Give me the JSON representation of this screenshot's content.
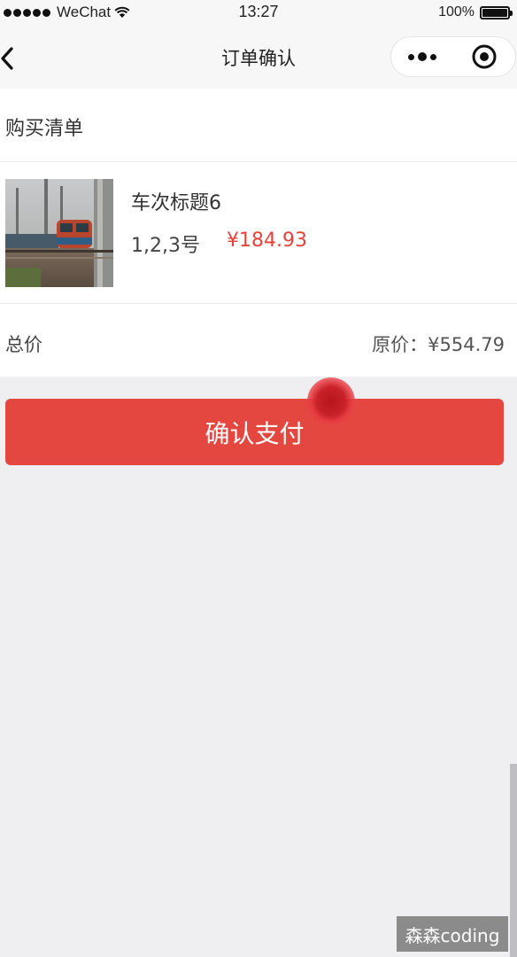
{
  "status_bar": {
    "carrier": "WeChat",
    "time": "13:27",
    "battery": "100%",
    "battery_level": 1.0
  },
  "nav": {
    "title": "订单确认"
  },
  "order": {
    "section_title": "购买清单",
    "item": {
      "title": "车次标题6",
      "seats": "1,2,3号",
      "price": "¥184.93"
    },
    "total_label": "总价",
    "original_price": "原价：¥554.79"
  },
  "actions": {
    "confirm_label": "确认支付"
  },
  "watermark": "森森coding",
  "colors": {
    "accent": "#e4473f",
    "price": "#e5423a",
    "background": "#efeff1"
  }
}
